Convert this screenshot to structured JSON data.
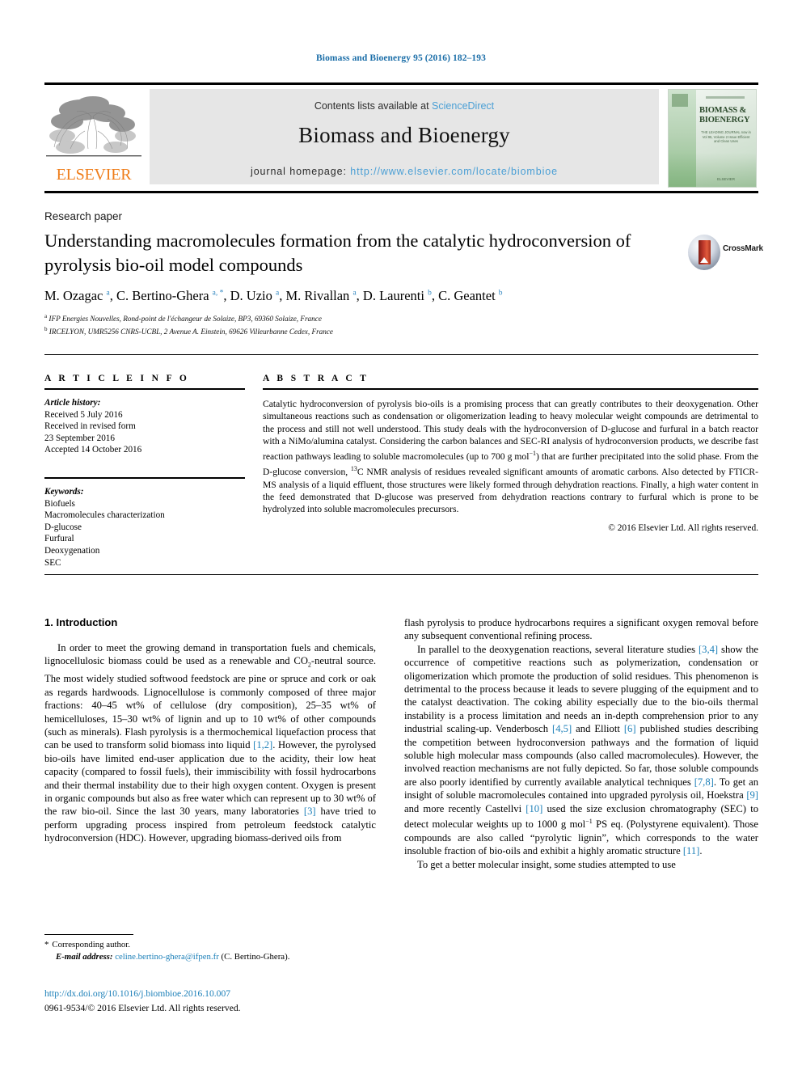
{
  "running_head": "Biomass and Bioenergy 95 (2016) 182–193",
  "journal_header": {
    "contents_prefix": "Contents lists available at ",
    "contents_link": "ScienceDirect",
    "journal_title": "Biomass and Bioenergy",
    "homepage_prefix": "journal homepage: ",
    "homepage_url": "http://www.elsevier.com/locate/biombioe",
    "publisher_wordmark": "ELSEVIER",
    "cover": {
      "title_line1": "BIOMASS &",
      "title_line2": "BIOENERGY",
      "subtitle": "THE LEADING JOURNAL\nnow in Vol 95, Volume 2 Issue\nEfficient and Clean Uses",
      "footer": "ELSEVIER"
    },
    "band_color": "#e6e6e6",
    "link_color": "#4a9fd5",
    "elsevier_orange": "#ef7d1a"
  },
  "article": {
    "type": "Research paper",
    "title": "Understanding macromolecules formation from the catalytic hydroconversion of pyrolysis bio-oil model compounds",
    "authors_html": "M. Ozagac <sup>a</sup>, C. Bertino-Ghera <sup>a, *</sup>, D. Uzio <sup>a</sup>, M. Rivallan <sup>a</sup>, D. Laurenti <sup>b</sup>, C. Geantet <sup>b</sup>",
    "affiliation_a": "IFP Energies Nouvelles, Rond-point de l'échangeur de Solaize, BP3, 69360 Solaize, France",
    "affiliation_b": "IRCELYON, UMR5256 CNRS-UCBL, 2 Avenue A. Einstein, 69626 Villeurbanne Cedex, France",
    "crossmark_label": "CrossMark"
  },
  "article_info": {
    "heading": "A R T I C L E   I N F O",
    "history_label": "Article history:",
    "history_lines": [
      "Received 5 July 2016",
      "Received in revised form",
      "23 September 2016",
      "Accepted 14 October 2016"
    ],
    "keywords_label": "Keywords:",
    "keywords": [
      "Biofuels",
      "Macromolecules characterization",
      "D-glucose",
      "Furfural",
      "Deoxygenation",
      "SEC"
    ]
  },
  "abstract": {
    "heading": "A B S T R A C T",
    "text_part1": "Catalytic hydroconversion of pyrolysis bio-oils is a promising process that can greatly contributes to their deoxygenation. Other simultaneous reactions such as condensation or oligomerization leading to heavy molecular weight compounds are detrimental to the process and still not well understood. This study deals with the hydroconversion of D-glucose and furfural in a batch reactor with a NiMo/alumina catalyst. Considering the carbon balances and SEC-RI analysis of hydroconversion products, we describe fast reaction pathways leading to soluble macromolecules (up to 700 g mol",
    "sup1": "−1",
    "text_part2": ") that are further precipitated into the solid phase. From the D-glucose conversion, ",
    "sup2": "13",
    "text_part3": "C NMR analysis of residues revealed significant amounts of aromatic carbons. Also detected by FTICR-MS analysis of a liquid effluent, those structures were likely formed through dehydration reactions. Finally, a high water content in the feed demonstrated that D-glucose was preserved from dehydration reactions contrary to furfural which is prone to be hydrolyzed into soluble macromolecules precursors.",
    "copyright": "© 2016 Elsevier Ltd. All rights reserved."
  },
  "body": {
    "section_heading": "1. Introduction",
    "left_p1_a": "In order to meet the growing demand in transportation fuels and chemicals, lignocellulosic biomass could be used as a renewable and CO",
    "left_p1_sub": "2",
    "left_p1_b": "-neutral source. The most widely studied softwood feedstock are pine or spruce and cork or oak as regards hardwoods. Lignocellulose is commonly composed of three major fractions: 40–45 wt% of cellulose (dry composition), 25–35 wt% of hemicelluloses, 15–30 wt% of lignin and up to 10 wt% of other compounds (such as minerals). Flash pyrolysis is a thermochemical liquefaction process that can be used to transform solid biomass into liquid ",
    "left_ref_12": "[1,2]",
    "left_p1_c": ". However, the pyrolysed bio-oils have limited end-user application due to the acidity, their low heat capacity (compared to fossil fuels), their immiscibility with fossil hydrocarbons and their thermal instability due to their high oxygen content. Oxygen is present in organic compounds but also as free water which can represent up to 30 wt% of the raw bio-oil. Since the last 30 years, many laboratories ",
    "left_ref_3": "[3]",
    "left_p1_d": " have tried to perform upgrading process inspired from petroleum feedstock catalytic hydroconversion (HDC). However, upgrading biomass-derived oils from",
    "right_p1": "flash pyrolysis to produce hydrocarbons requires a significant oxygen removal before any subsequent conventional refining process.",
    "right_p2_a": "In parallel to the deoxygenation reactions, several literature studies ",
    "right_ref_34": "[3,4]",
    "right_p2_b": " show the occurrence of competitive reactions such as polymerization, condensation or oligomerization which promote the production of solid residues. This phenomenon is detrimental to the process because it leads to severe plugging of the equipment and to the catalyst deactivation. The coking ability especially due to the bio-oils thermal instability is a process limitation and needs an in-depth comprehension prior to any industrial scaling-up. Venderbosch ",
    "right_ref_45": "[4,5]",
    "right_p2_c": " and Elliott ",
    "right_ref_6": "[6]",
    "right_p2_d": " published studies describing the competition between hydroconversion pathways and the formation of liquid soluble high molecular mass compounds (also called macromolecules). However, the involved reaction mechanisms are not fully depicted. So far, those soluble compounds are also poorly identified by currently available analytical techniques ",
    "right_ref_78": "[7,8]",
    "right_p2_e": ". To get an insight of soluble macromolecules contained into upgraded pyrolysis oil, Hoekstra ",
    "right_ref_9": "[9]",
    "right_p2_f": " and more recently Castellvi ",
    "right_ref_10": "[10]",
    "right_p2_g": " used the size exclusion chromatography (SEC) to detect molecular weights up to 1000 g mol",
    "right_sup": "−1",
    "right_p2_h": " PS eq. (Polystyrene equivalent). Those compounds are also called “pyrolytic lignin”, which corresponds to the water insoluble fraction of bio-oils and exhibit a highly aromatic structure ",
    "right_ref_11": "[11]",
    "right_p2_i": ".",
    "right_p3": "To get a better molecular insight, some studies attempted to use"
  },
  "footer": {
    "corresponding_star": "*",
    "corresponding_label": "Corresponding author.",
    "email_label": "E-mail address:",
    "email": "celine.bertino-ghera@ifpen.fr",
    "email_owner": "(C. Bertino-Ghera).",
    "doi": "http://dx.doi.org/10.1016/j.biombioe.2016.10.007",
    "issn_line": "0961-9534/© 2016 Elsevier Ltd. All rights reserved."
  }
}
